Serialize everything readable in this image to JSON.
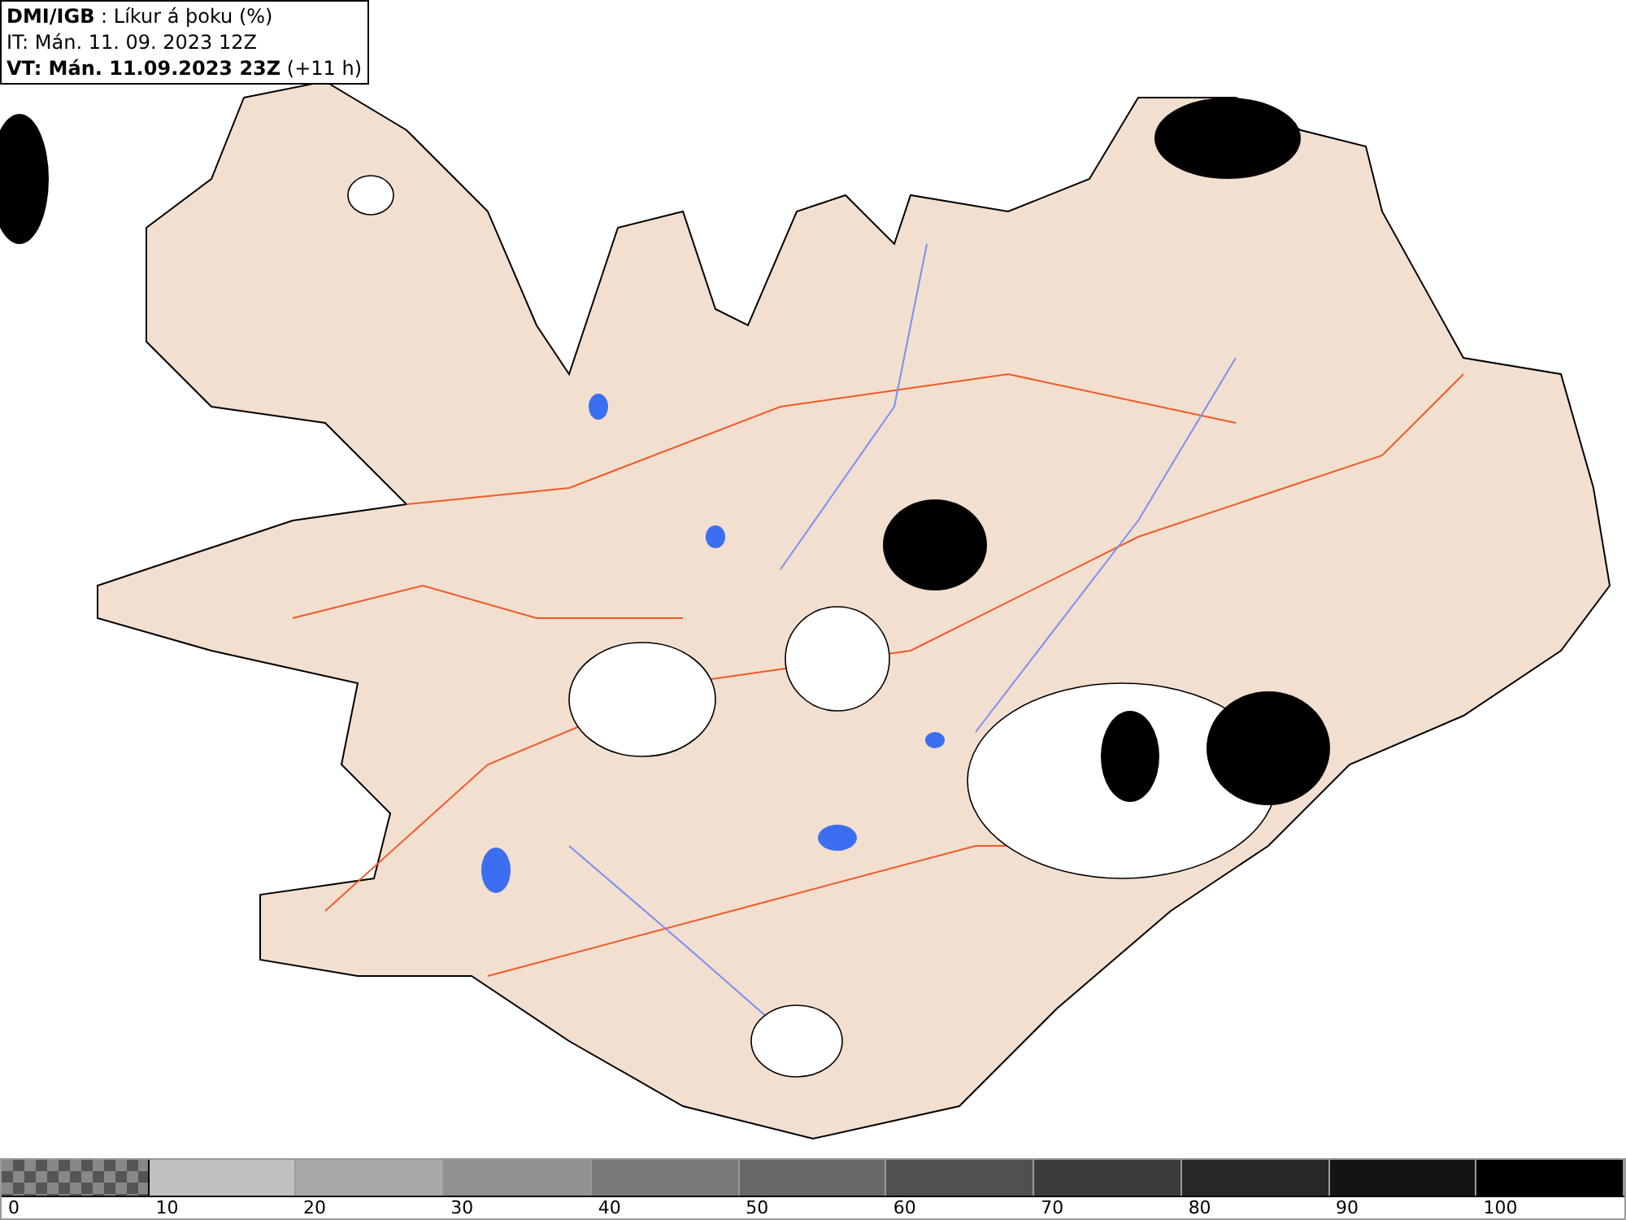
{
  "info_box": {
    "lines": [
      "**DMI/IGB** : Líkur á þoku (%)",
      "IT: Mán. 11. 09. 2023 12Z",
      "**VT: Mán. 11.09.2023 23Z** (+11 h)"
    ]
  },
  "legend": [
    {
      "kind": "checker",
      "label": "0"
    },
    {
      "kind": "solid",
      "color": "#c0c0c0",
      "label": "10"
    },
    {
      "kind": "solid",
      "color": "#a8a8a8",
      "label": "20"
    },
    {
      "kind": "solid",
      "color": "#909090",
      "label": "30"
    },
    {
      "kind": "solid",
      "color": "#7a7a7a",
      "label": "40"
    },
    {
      "kind": "solid",
      "color": "#686868",
      "label": "50"
    },
    {
      "kind": "solid",
      "color": "#505050",
      "label": "60"
    },
    {
      "kind": "solid",
      "color": "#3c3c3c",
      "label": "70"
    },
    {
      "kind": "solid",
      "color": "#282828",
      "label": "80"
    },
    {
      "kind": "solid",
      "color": "#141414",
      "label": "90"
    },
    {
      "kind": "solid",
      "color": "#000000",
      "label": "100"
    }
  ]
}
